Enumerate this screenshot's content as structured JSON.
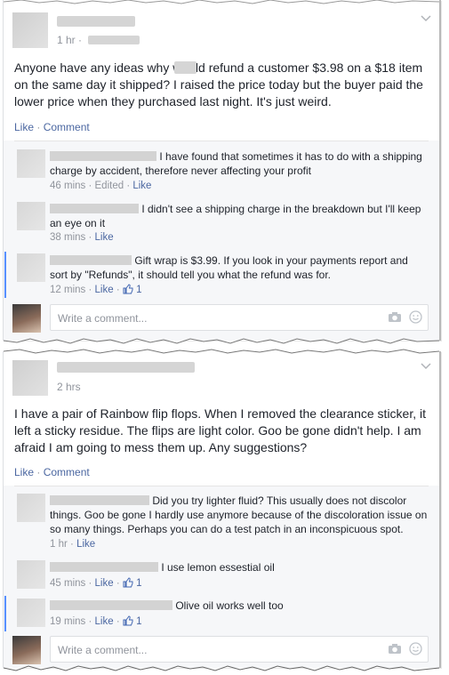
{
  "posts": [
    {
      "time": "1 hr ·",
      "text": "Anyone have any ideas why        would refund a customer $3.98 on a $18 item on the same day it shipped? I raised the price today but the buyer paid the lower price when they purchased last night. It's just weird.",
      "actions": {
        "like": "Like",
        "sep": " · ",
        "comment": "Comment"
      },
      "comments": [
        {
          "text": " I have found that sometimes it has to do with a shipping charge by accident, therefore never affecting your profit",
          "meta_time": "46 mins",
          "meta_edited": "Edited",
          "meta_like": "Like",
          "likes": ""
        },
        {
          "text": " I didn't see a shipping charge in the breakdown but I'll keep an eye on it",
          "meta_time": "38 mins",
          "meta_edited": "",
          "meta_like": "Like",
          "likes": ""
        },
        {
          "text": " Gift wrap is $3.99. If you look in your payments report and sort by \"Refunds\", it should tell you what the refund was for.",
          "meta_time": "12 mins",
          "meta_edited": "",
          "meta_like": "Like",
          "likes": "1"
        }
      ],
      "write_placeholder": "Write a comment..."
    },
    {
      "time": "2 hrs",
      "text": "I have a pair of Rainbow flip flops. When I removed the clearance sticker, it left a sticky residue. The flips are light color. Goo be gone didn't help. I am afraid I am going to mess them up. Any suggestions?",
      "actions": {
        "like": "Like",
        "sep": " · ",
        "comment": "Comment"
      },
      "comments": [
        {
          "text": " Did you try lighter fluid? This usually does not discolor things. Goo be gone I hardly use anymore because of the discoloration issue on so many things. Perhaps you can do a test patch in an inconspicuous spot.",
          "meta_time": "1 hr",
          "meta_edited": "",
          "meta_like": "Like",
          "likes": ""
        },
        {
          "text": " I use lemon essestial oil",
          "meta_time": "45 mins",
          "meta_edited": "",
          "meta_like": "Like",
          "likes": "1"
        },
        {
          "text": " Olive oil works well too",
          "meta_time": "19 mins",
          "meta_edited": "",
          "meta_like": "Like",
          "likes": "1"
        }
      ],
      "write_placeholder": "Write a comment..."
    }
  ],
  "icons": {
    "camera": "camera-icon",
    "emoji": "emoji-icon",
    "chevron": "chevron-down-icon",
    "thumb": "thumbs-up-icon"
  },
  "colors": {
    "link": "#4b67a1",
    "meta": "#90949c",
    "accent_bar": "#5890ff",
    "like_blue": "#4267b2"
  }
}
